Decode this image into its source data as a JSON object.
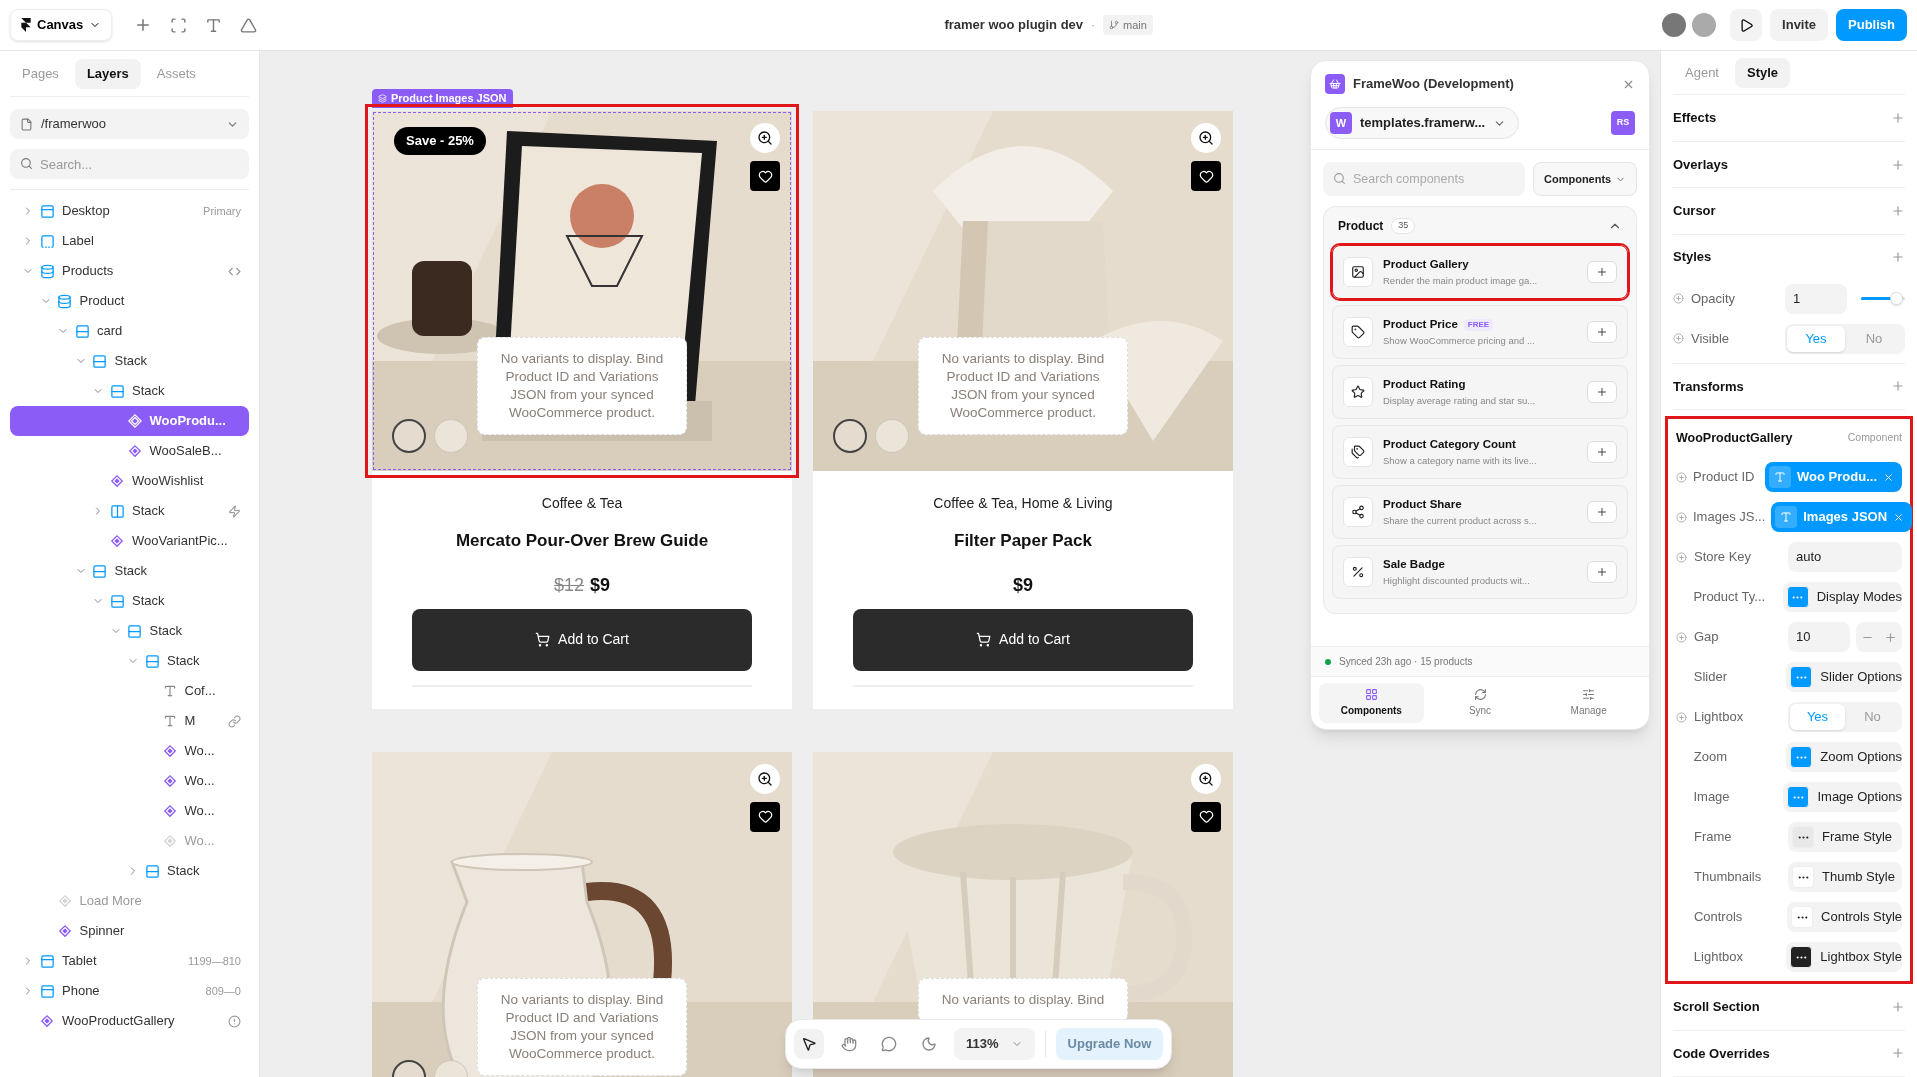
{
  "topbar": {
    "menu": "Canvas",
    "title": "framer woo plugin dev",
    "separator": "·",
    "branch": "main",
    "invite": "Invite",
    "publish": "Publish"
  },
  "left_panel": {
    "tabs": [
      {
        "label": "Pages",
        "selected": false
      },
      {
        "label": "Layers",
        "selected": true
      },
      {
        "label": "Assets",
        "selected": false
      }
    ],
    "page": "/framerwoo",
    "search": {
      "placeholder": "Search..."
    },
    "layers": [
      {
        "name": "Desktop",
        "kind": "frame",
        "expanded": false,
        "meta": "Primary"
      },
      {
        "name": "Label",
        "kind": "label",
        "expanded": false
      },
      {
        "name": "Products",
        "kind": "cms",
        "expanded": true,
        "trailing": {
          "kind": "code"
        },
        "children": [
          {
            "name": "Product",
            "kind": "cms",
            "expanded": true,
            "children": [
              {
                "name": "card",
                "kind": "stack",
                "expanded": true,
                "children": [
                  {
                    "name": "Stack",
                    "kind": "stack",
                    "expanded": true,
                    "children": [
                      {
                        "name": "Stack",
                        "kind": "stack",
                        "expanded": true,
                        "children": [
                          {
                            "name": "WooProdu...",
                            "kind": "component",
                            "selected": true
                          },
                          {
                            "name": "WooSaleB...",
                            "kind": "component"
                          }
                        ]
                      },
                      {
                        "name": "WooWishlist",
                        "kind": "component"
                      },
                      {
                        "name": "Stack",
                        "kind": "hstack",
                        "expanded": false,
                        "trailing": {
                          "kind": "bolt"
                        }
                      },
                      {
                        "name": "WooVariantPic...",
                        "kind": "component"
                      }
                    ]
                  },
                  {
                    "name": "Stack",
                    "kind": "stack",
                    "expanded": true,
                    "children": [
                      {
                        "name": "Stack",
                        "kind": "stack",
                        "expanded": true,
                        "children": [
                          {
                            "name": "Stack",
                            "kind": "stack",
                            "expanded": true,
                            "children": [
                              {
                                "name": "Stack",
                                "kind": "stack",
                                "expanded": true,
                                "children": [
                                  {
                                    "name": "Cof...",
                                    "kind": "text"
                                  },
                                  {
                                    "name": "M",
                                    "kind": "text",
                                    "trailing": {
                                      "kind": "link"
                                    }
                                  },
                                  {
                                    "name": "Wo...",
                                    "kind": "component"
                                  },
                                  {
                                    "name": "Wo...",
                                    "kind": "component"
                                  },
                                  {
                                    "name": "Wo...",
                                    "kind": "component"
                                  },
                                  {
                                    "name": "Wo...",
                                    "kind": "component",
                                    "disabled": true
                                  }
                                ]
                              },
                              {
                                "name": "Stack",
                                "kind": "stack",
                                "expanded": false
                              }
                            ]
                          }
                        ]
                      }
                    ]
                  }
                ]
              }
            ]
          },
          {
            "name": "Load More",
            "kind": "component",
            "disabled": true
          },
          {
            "name": "Spinner",
            "kind": "component"
          }
        ]
      },
      {
        "name": "Tablet",
        "kind": "frame",
        "expanded": false,
        "meta": "1199—810"
      },
      {
        "name": "Phone",
        "kind": "frame",
        "expanded": false,
        "meta": "809—0"
      },
      {
        "name": "WooProductGallery",
        "kind": "component",
        "trailing": {
          "kind": "alert"
        }
      }
    ]
  },
  "canvas": {
    "frame_label": "Product Images JSON",
    "products": [
      {
        "highlighted": true,
        "thumbnails": [
          {
            "selected": true
          },
          {
            "selected": false
          }
        ],
        "badge": "Save - 25%",
        "note": "No variants to display. Bind Product ID and Variations JSON from your synced WooCommerce product.",
        "category": "Coffee & Tea",
        "name": "Mercato Pour-Over Brew Guide",
        "old_price": "$12",
        "price": "$9",
        "button": "Add to Cart"
      },
      {
        "highlighted": false,
        "thumbnails": [
          {
            "selected": true
          },
          {
            "selected": false
          }
        ],
        "note": "No variants to display. Bind Product ID and Variations JSON from your synced WooCommerce product.",
        "category": "Coffee & Tea, Home & Living",
        "name": "Filter Paper Pack",
        "price": "$9",
        "button": "Add to Cart"
      },
      {
        "highlighted": false,
        "thumbnails": [
          {
            "selected": true
          },
          {
            "selected": false
          }
        ],
        "note": "No variants to display. Bind Product ID and Variations JSON from your synced WooCommerce product."
      },
      {
        "highlighted": false,
        "note": "No variants to display. Bind"
      }
    ]
  },
  "plugin": {
    "title": "FrameWoo (Development)",
    "site_initial": "W",
    "site": "templates.framerw...",
    "avatar": "RS",
    "search": {
      "placeholder": "Search components"
    },
    "filter": "Components",
    "group": {
      "title": "Product",
      "count": "35",
      "expanded": true,
      "items": [
        {
          "title": "Product Gallery",
          "description": "Render the main product image ga...",
          "highlighted": true
        },
        {
          "title": "Product Price",
          "badge": "FREE",
          "description": "Show WooCommerce pricing and ...",
          "highlighted": false
        },
        {
          "title": "Product Rating",
          "description": "Display average rating and star su...",
          "highlighted": false
        },
        {
          "title": "Product Category Count",
          "description": "Show a category name with its live...",
          "highlighted": false
        },
        {
          "title": "Product Share",
          "description": "Share the current product across s...",
          "highlighted": false
        },
        {
          "title": "Sale Badge",
          "description": "Highlight discounted products wit...",
          "highlighted": false
        }
      ]
    },
    "status": "Synced 23h ago · 15 products",
    "nav": [
      {
        "label": "Components",
        "selected": true
      },
      {
        "label": "Sync",
        "selected": false
      },
      {
        "label": "Manage",
        "selected": false
      }
    ]
  },
  "right_panel": {
    "tabs": [
      {
        "label": "Agent",
        "selected": false
      },
      {
        "label": "Style",
        "selected": true
      }
    ],
    "sections_top": [
      "Effects",
      "Overlays",
      "Cursor"
    ],
    "styles": {
      "title": "Styles",
      "rows": [
        {
          "kind": "slider",
          "label": "Opacity",
          "value": "1",
          "level": 0.95,
          "variable": true
        },
        {
          "kind": "toggle",
          "label": "Visible",
          "variable": true,
          "options": [
            {
              "label": "Yes",
              "selected": true
            },
            {
              "label": "No",
              "selected": false
            }
          ]
        }
      ]
    },
    "transforms": "Transforms",
    "component": {
      "title": "WooProductGallery",
      "tag": "Component",
      "highlighted": true,
      "rows": [
        {
          "kind": "binding",
          "label": "Product ID",
          "value": "Woo Produ...",
          "variable": true
        },
        {
          "kind": "binding",
          "label": "Images JS...",
          "value": "Images JSON",
          "variable": true
        },
        {
          "kind": "text",
          "label": "Store Key",
          "value": "auto",
          "variable": true
        },
        {
          "kind": "option",
          "label": "Product Ty...",
          "value": "Display Modes",
          "color": "#0099ff",
          "variable": false
        },
        {
          "kind": "stepper",
          "label": "Gap",
          "value": "10",
          "variable": true
        },
        {
          "kind": "option",
          "label": "Slider",
          "value": "Slider Options",
          "color": "#0099ff",
          "variable": false
        },
        {
          "kind": "toggle",
          "label": "Lightbox",
          "variable": true,
          "options": [
            {
              "label": "Yes",
              "selected": true
            },
            {
              "label": "No",
              "selected": false
            }
          ]
        },
        {
          "kind": "option",
          "label": "Zoom",
          "value": "Zoom Options",
          "color": "#0099ff",
          "variable": false
        },
        {
          "kind": "option",
          "label": "Image",
          "value": "Image Options",
          "color": "#0099ff",
          "variable": false
        },
        {
          "kind": "option",
          "label": "Frame",
          "value": "Frame Style",
          "color": "#e8e8e8",
          "variable": false
        },
        {
          "kind": "option",
          "label": "Thumbnails",
          "value": "Thumb Style",
          "color": "#ffffff",
          "variable": false
        },
        {
          "kind": "option",
          "label": "Controls",
          "value": "Controls Style",
          "color": "#ffffff",
          "variable": false
        },
        {
          "kind": "option",
          "label": "Lightbox",
          "value": "Lightbox Style",
          "color": "#222222",
          "variable": false
        }
      ]
    },
    "sections_bottom": [
      "Scroll Section",
      "Code Overrides"
    ]
  },
  "toolbar": {
    "tools": [
      {
        "selected": true
      },
      {
        "selected": false
      },
      {
        "selected": false
      },
      {
        "selected": false
      }
    ],
    "zoom": "113%",
    "upgrade": "Upgrade Now"
  }
}
